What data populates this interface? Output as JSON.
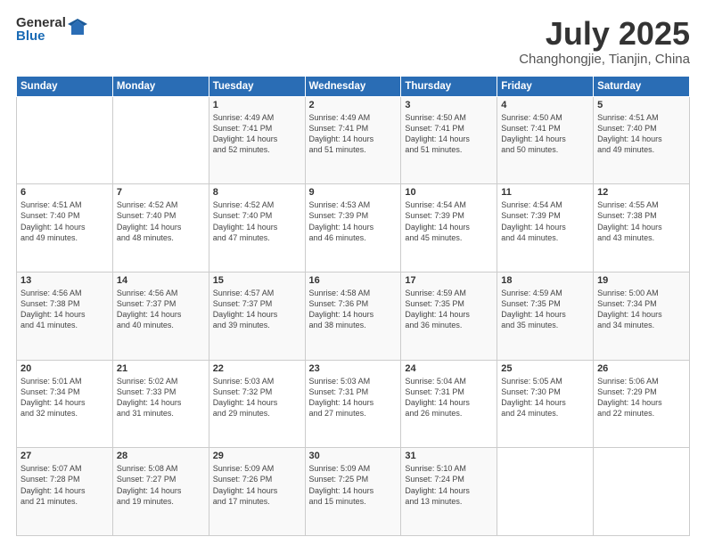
{
  "logo": {
    "general": "General",
    "blue": "Blue"
  },
  "title": "July 2025",
  "subtitle": "Changhongjie, Tianjin, China",
  "headers": [
    "Sunday",
    "Monday",
    "Tuesday",
    "Wednesday",
    "Thursday",
    "Friday",
    "Saturday"
  ],
  "weeks": [
    [
      {
        "day": "",
        "detail": ""
      },
      {
        "day": "",
        "detail": ""
      },
      {
        "day": "1",
        "detail": "Sunrise: 4:49 AM\nSunset: 7:41 PM\nDaylight: 14 hours\nand 52 minutes."
      },
      {
        "day": "2",
        "detail": "Sunrise: 4:49 AM\nSunset: 7:41 PM\nDaylight: 14 hours\nand 51 minutes."
      },
      {
        "day": "3",
        "detail": "Sunrise: 4:50 AM\nSunset: 7:41 PM\nDaylight: 14 hours\nand 51 minutes."
      },
      {
        "day": "4",
        "detail": "Sunrise: 4:50 AM\nSunset: 7:41 PM\nDaylight: 14 hours\nand 50 minutes."
      },
      {
        "day": "5",
        "detail": "Sunrise: 4:51 AM\nSunset: 7:40 PM\nDaylight: 14 hours\nand 49 minutes."
      }
    ],
    [
      {
        "day": "6",
        "detail": "Sunrise: 4:51 AM\nSunset: 7:40 PM\nDaylight: 14 hours\nand 49 minutes."
      },
      {
        "day": "7",
        "detail": "Sunrise: 4:52 AM\nSunset: 7:40 PM\nDaylight: 14 hours\nand 48 minutes."
      },
      {
        "day": "8",
        "detail": "Sunrise: 4:52 AM\nSunset: 7:40 PM\nDaylight: 14 hours\nand 47 minutes."
      },
      {
        "day": "9",
        "detail": "Sunrise: 4:53 AM\nSunset: 7:39 PM\nDaylight: 14 hours\nand 46 minutes."
      },
      {
        "day": "10",
        "detail": "Sunrise: 4:54 AM\nSunset: 7:39 PM\nDaylight: 14 hours\nand 45 minutes."
      },
      {
        "day": "11",
        "detail": "Sunrise: 4:54 AM\nSunset: 7:39 PM\nDaylight: 14 hours\nand 44 minutes."
      },
      {
        "day": "12",
        "detail": "Sunrise: 4:55 AM\nSunset: 7:38 PM\nDaylight: 14 hours\nand 43 minutes."
      }
    ],
    [
      {
        "day": "13",
        "detail": "Sunrise: 4:56 AM\nSunset: 7:38 PM\nDaylight: 14 hours\nand 41 minutes."
      },
      {
        "day": "14",
        "detail": "Sunrise: 4:56 AM\nSunset: 7:37 PM\nDaylight: 14 hours\nand 40 minutes."
      },
      {
        "day": "15",
        "detail": "Sunrise: 4:57 AM\nSunset: 7:37 PM\nDaylight: 14 hours\nand 39 minutes."
      },
      {
        "day": "16",
        "detail": "Sunrise: 4:58 AM\nSunset: 7:36 PM\nDaylight: 14 hours\nand 38 minutes."
      },
      {
        "day": "17",
        "detail": "Sunrise: 4:59 AM\nSunset: 7:35 PM\nDaylight: 14 hours\nand 36 minutes."
      },
      {
        "day": "18",
        "detail": "Sunrise: 4:59 AM\nSunset: 7:35 PM\nDaylight: 14 hours\nand 35 minutes."
      },
      {
        "day": "19",
        "detail": "Sunrise: 5:00 AM\nSunset: 7:34 PM\nDaylight: 14 hours\nand 34 minutes."
      }
    ],
    [
      {
        "day": "20",
        "detail": "Sunrise: 5:01 AM\nSunset: 7:34 PM\nDaylight: 14 hours\nand 32 minutes."
      },
      {
        "day": "21",
        "detail": "Sunrise: 5:02 AM\nSunset: 7:33 PM\nDaylight: 14 hours\nand 31 minutes."
      },
      {
        "day": "22",
        "detail": "Sunrise: 5:03 AM\nSunset: 7:32 PM\nDaylight: 14 hours\nand 29 minutes."
      },
      {
        "day": "23",
        "detail": "Sunrise: 5:03 AM\nSunset: 7:31 PM\nDaylight: 14 hours\nand 27 minutes."
      },
      {
        "day": "24",
        "detail": "Sunrise: 5:04 AM\nSunset: 7:31 PM\nDaylight: 14 hours\nand 26 minutes."
      },
      {
        "day": "25",
        "detail": "Sunrise: 5:05 AM\nSunset: 7:30 PM\nDaylight: 14 hours\nand 24 minutes."
      },
      {
        "day": "26",
        "detail": "Sunrise: 5:06 AM\nSunset: 7:29 PM\nDaylight: 14 hours\nand 22 minutes."
      }
    ],
    [
      {
        "day": "27",
        "detail": "Sunrise: 5:07 AM\nSunset: 7:28 PM\nDaylight: 14 hours\nand 21 minutes."
      },
      {
        "day": "28",
        "detail": "Sunrise: 5:08 AM\nSunset: 7:27 PM\nDaylight: 14 hours\nand 19 minutes."
      },
      {
        "day": "29",
        "detail": "Sunrise: 5:09 AM\nSunset: 7:26 PM\nDaylight: 14 hours\nand 17 minutes."
      },
      {
        "day": "30",
        "detail": "Sunrise: 5:09 AM\nSunset: 7:25 PM\nDaylight: 14 hours\nand 15 minutes."
      },
      {
        "day": "31",
        "detail": "Sunrise: 5:10 AM\nSunset: 7:24 PM\nDaylight: 14 hours\nand 13 minutes."
      },
      {
        "day": "",
        "detail": ""
      },
      {
        "day": "",
        "detail": ""
      }
    ]
  ]
}
